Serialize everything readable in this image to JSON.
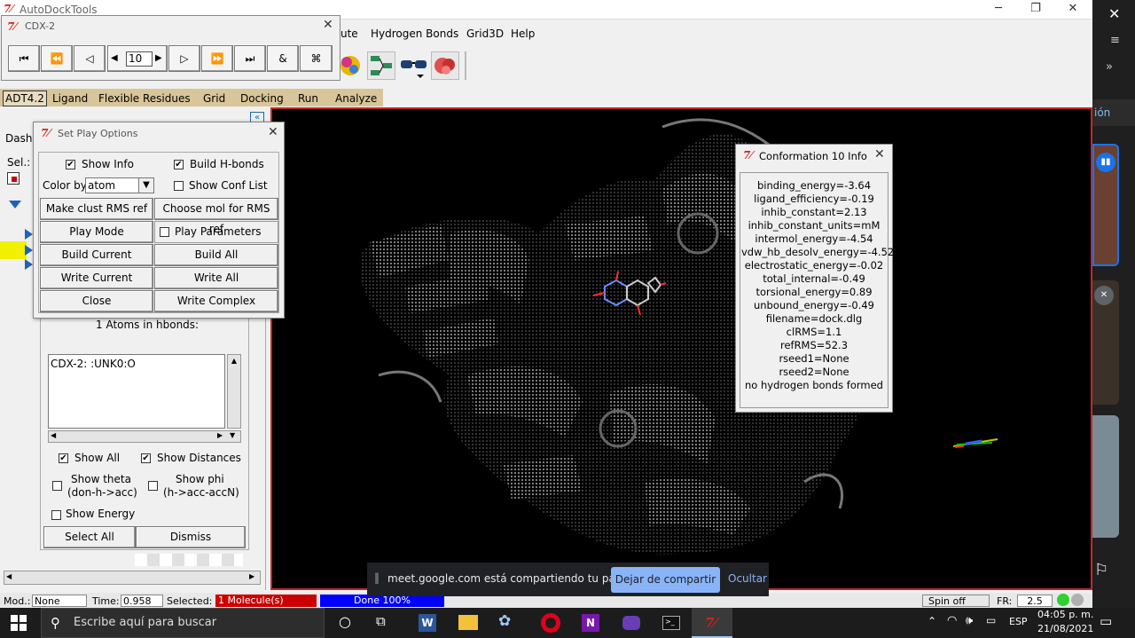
{
  "app": {
    "title": "AutoDockTools",
    "icon_glyph": "7⁄"
  },
  "menubar": {
    "items": [
      "ute",
      "Hydrogen Bonds",
      "Grid3D",
      "Help"
    ]
  },
  "adt_tabs": [
    "ADT4.2",
    "Ligand",
    "Flexible Residues",
    "Grid",
    "Docking",
    "Run",
    "Analyze"
  ],
  "cdx": {
    "title": "CDX-2",
    "frame": "10",
    "buttons": [
      "first-icon",
      "rewind-icon",
      "step-back-icon",
      "prev-icon",
      "next-icon",
      "play-icon",
      "forward-icon",
      "last-icon",
      "loop-icon",
      "command-icon"
    ]
  },
  "dashboard": {
    "tab_label": "Dashb",
    "sel_label": "Sel.:",
    "hbond_count": "1 Atoms in hbonds:",
    "list_items": [
      "CDX-2: :UNK0:O"
    ],
    "show_all": "Show All",
    "show_distances": "Show Distances",
    "show_theta": "Show theta",
    "show_theta_sub": "(don-h->acc)",
    "show_phi": "Show phi",
    "show_phi_sub": "(h->acc-accN)",
    "show_energy": "Show Energy",
    "select_all": "Select All",
    "dismiss": "Dismiss"
  },
  "play_options": {
    "title": "Set Play Options",
    "show_info": "Show Info",
    "build_hbonds": "Build  H-bonds",
    "color_by": "Color by",
    "color_value": "atom",
    "show_conf_list": "Show Conf List",
    "make_clust": "Make clust RMS ref",
    "choose_mol": "Choose mol for RMS ref",
    "play_mode": "Play Mode",
    "play_params": "Play Parameters",
    "build_current": "Build Current",
    "build_all": "Build All",
    "write_current": "Write Current",
    "write_all": "Write All",
    "close": "Close",
    "write_complex": "Write Complex"
  },
  "conf_info": {
    "title": "Conformation 10 Info",
    "lines": [
      "binding_energy=-3.64",
      "ligand_efficiency=-0.19",
      "inhib_constant=2.13",
      "inhib_constant_units=mM",
      "intermol_energy=-4.54",
      "vdw_hb_desolv_energy=-4.52",
      "electrostatic_energy=-0.02",
      "total_internal=-0.49",
      "torsional_energy=0.89",
      "unbound_energy=-0.49",
      "filename=dock.dlg",
      "clRMS=1.1",
      "refRMS=52.3",
      "rseed1=None",
      "rseed2=None",
      "no hydrogen bonds formed"
    ]
  },
  "status": {
    "mod": "Mod.:",
    "mod_value": "None",
    "time": "Time:",
    "time_value": "0.958",
    "selected": "Selected:",
    "selected_value": "1 Molecule(s)",
    "done": "Done 100%",
    "spin": "Spin off",
    "fr": "FR:",
    "fr_value": "2.5"
  },
  "share": {
    "message": "meet.google.com está compartiendo tu pantalla.",
    "stop": "Dejar de compartir",
    "hide": "Ocultar"
  },
  "right_strip": {
    "partial_label": "ión"
  },
  "taskbar": {
    "search_placeholder": "Escribe aquí para buscar",
    "lang": "ESP",
    "time": "04:05 p. m.",
    "date": "21/08/2021"
  },
  "colors": {
    "adt_bar": "#d9c59a",
    "view_border": "#c0282c",
    "share_button": "#8ab4f8",
    "done_bar": "#0000ff",
    "selected_bar": "#cc0000"
  }
}
